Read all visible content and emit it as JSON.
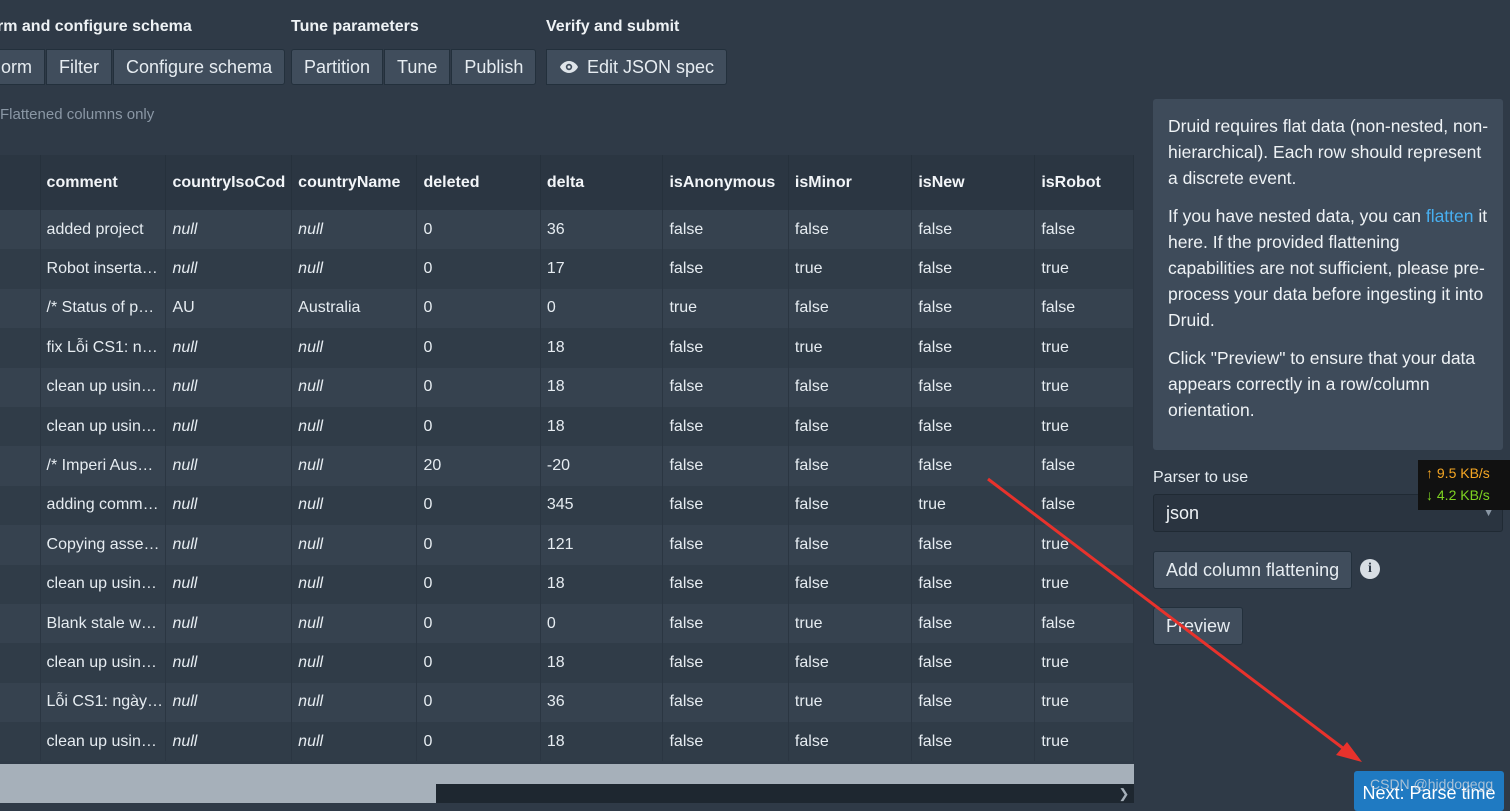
{
  "steps": {
    "transform": {
      "title": "rm and configure schema",
      "buttons": [
        "orm",
        "Filter",
        "Configure schema"
      ]
    },
    "tune": {
      "title": "Tune parameters",
      "buttons": [
        "Partition",
        "Tune",
        "Publish"
      ]
    },
    "verify": {
      "title": "Verify and submit",
      "button": "Edit JSON spec"
    }
  },
  "filter_label": "Flattened columns only",
  "table": {
    "columns": [
      "",
      "comment",
      "countryIsoCod",
      "countryName",
      "deleted",
      "delta",
      "isAnonymous",
      "isMinor",
      "isNew",
      "isRobot"
    ],
    "rows": [
      [
        "",
        "added project",
        "null",
        "null",
        "0",
        "36",
        "false",
        "false",
        "false",
        "false"
      ],
      [
        "",
        "Robot inserta…",
        "null",
        "null",
        "0",
        "17",
        "false",
        "true",
        "false",
        "true"
      ],
      [
        "",
        "/* Status of p…",
        "AU",
        "Australia",
        "0",
        "0",
        "true",
        "false",
        "false",
        "false"
      ],
      [
        "",
        "fix Lỗi CS1: n…",
        "null",
        "null",
        "0",
        "18",
        "false",
        "true",
        "false",
        "true"
      ],
      [
        "",
        "clean up usin…",
        "null",
        "null",
        "0",
        "18",
        "false",
        "false",
        "false",
        "true"
      ],
      [
        "",
        "clean up usin…",
        "null",
        "null",
        "0",
        "18",
        "false",
        "false",
        "false",
        "true"
      ],
      [
        "",
        "/* Imperi Aus…",
        "null",
        "null",
        "20",
        "-20",
        "false",
        "false",
        "false",
        "false"
      ],
      [
        "",
        "adding comm…",
        "null",
        "null",
        "0",
        "345",
        "false",
        "false",
        "true",
        "false"
      ],
      [
        "",
        "Copying asse…",
        "null",
        "null",
        "0",
        "121",
        "false",
        "false",
        "false",
        "true"
      ],
      [
        "",
        "clean up usin…",
        "null",
        "null",
        "0",
        "18",
        "false",
        "false",
        "false",
        "true"
      ],
      [
        "",
        "Blank stale w…",
        "null",
        "null",
        "0",
        "0",
        "false",
        "true",
        "false",
        "false"
      ],
      [
        "",
        "clean up usin…",
        "null",
        "null",
        "0",
        "18",
        "false",
        "false",
        "false",
        "true"
      ],
      [
        "",
        "Lỗi CS1: ngày…",
        "null",
        "null",
        "0",
        "36",
        "false",
        "true",
        "false",
        "true"
      ],
      [
        "",
        "clean up usin…",
        "null",
        "null",
        "0",
        "18",
        "false",
        "false",
        "false",
        "true"
      ]
    ]
  },
  "info": {
    "p1": "Druid requires flat data (non-nested, non-hierarchical). Each row should represent a discrete event.",
    "p2_before": "If you have nested data, you can ",
    "p2_link": "flatten",
    "p2_after": " it here. If the provided flattening capabilities are not sufficient, please pre-process your data before ingesting it into Druid.",
    "p3": "Click \"Preview\" to ensure that your data appears correctly in a row/column orientation."
  },
  "parser": {
    "label": "Parser to use",
    "selected": "json"
  },
  "add_flattening_label": "Add column flattening",
  "info_icon_glyph": "i",
  "preview_label": "Preview",
  "next_label": "Next: Parse time",
  "speed": {
    "up": "↑ 9.5 KB/s",
    "down": "↓ 4.2 KB/s"
  },
  "watermark": "CSDN @hiddogegg",
  "colors": {
    "background": "#2f3a47",
    "accent": "#1f7ac2",
    "link": "#48aff0",
    "annotation_arrow": "#e8322c"
  }
}
